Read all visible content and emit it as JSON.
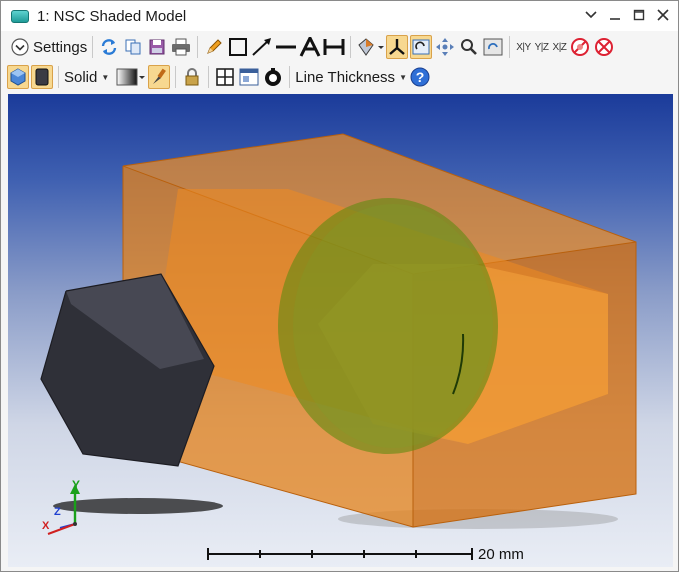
{
  "window": {
    "title": "1: NSC Shaded Model"
  },
  "toolbar1": {
    "settings_label": "Settings",
    "axis_labels": [
      "X|Y",
      "Y|Z",
      "X|Z"
    ]
  },
  "toolbar2": {
    "render_mode": "Solid",
    "line_thickness_label": "Line Thickness"
  },
  "viewport": {
    "scale_bar_label": "20 mm",
    "axis_triad": {
      "y": "Y",
      "z": "Z",
      "x": "X"
    }
  },
  "colors": {
    "background_top": "#1b3b9a",
    "background_bottom": "#e9edf5",
    "box": "#e27a10",
    "lens": "#4f7b0c",
    "hexagon": "#3d3e48"
  }
}
